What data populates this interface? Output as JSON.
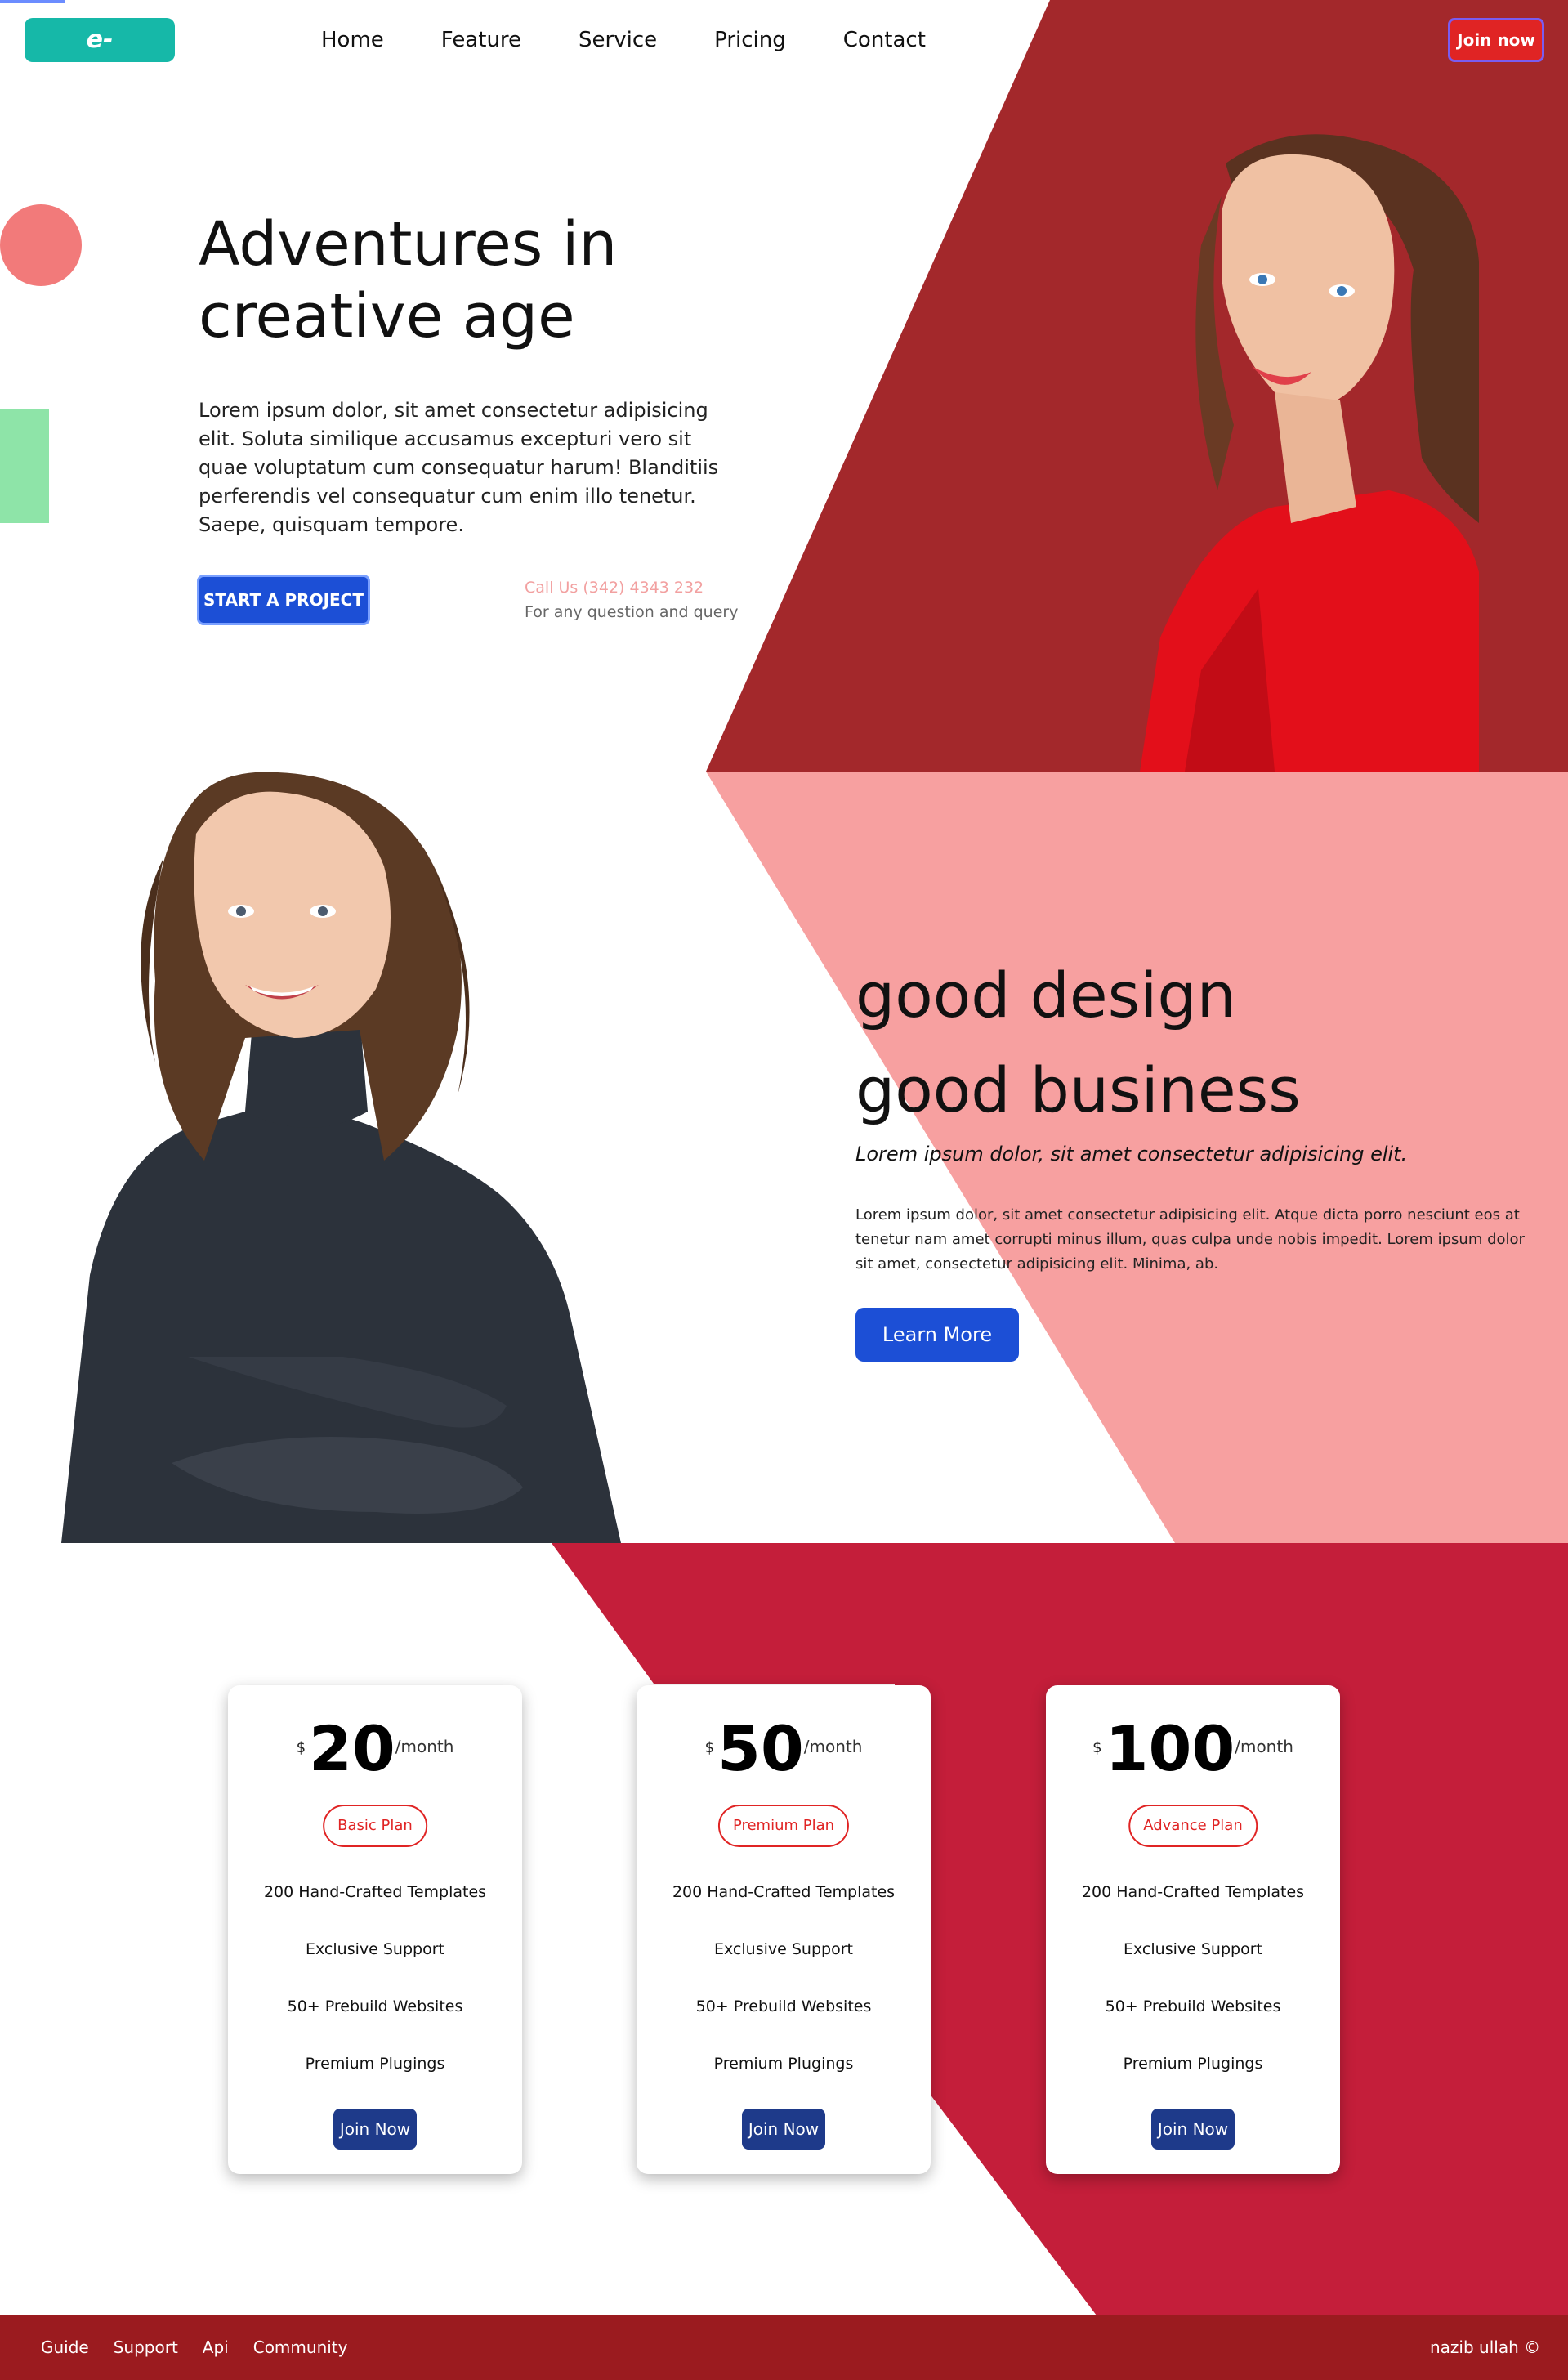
{
  "nav": {
    "logo": "e-commerce",
    "links": [
      "Home",
      "Feature",
      "Service",
      "Pricing",
      "Contact"
    ],
    "join_label": "Join now"
  },
  "hero": {
    "title_line1": "Adventures in",
    "title_line2": "creative age",
    "body": "Lorem ipsum dolor, sit amet consectetur adipisicing elit. Soluta similique accusamus excepturi vero sit quae voluptatum cum consequatur harum! Blanditiis perferendis vel consequatur cum enim illo tenetur. Saepe, quisquam tempore.",
    "cta_label": "START A PROJECT",
    "call_us": "Call Us (342) 4343 232",
    "call_sub": "For any question and query"
  },
  "design": {
    "title_line1": "good design",
    "title_line2": "good business",
    "italic": "Lorem ipsum dolor, sit amet consectetur adipisicing elit.",
    "body": "Lorem ipsum dolor, sit amet consectetur adipisicing elit. Atque dicta porro nesciunt eos at tenetur nam amet corrupti minus illum, quas culpa unde nobis impedit. Lorem ipsum dolor sit amet, consectetur adipisicing elit. Minima, ab.",
    "cta_label": "Learn More"
  },
  "pricing": {
    "plans": [
      {
        "currency": "$",
        "amount": "20",
        "period": "/month",
        "name": "Basic Plan",
        "features": [
          "200 Hand-Crafted Templates",
          "Exclusive Support",
          "50+ Prebuild Websites",
          "Premium Plugings"
        ],
        "button": "Join Now"
      },
      {
        "currency": "$",
        "amount": "50",
        "period": "/month",
        "name": "Premium Plan",
        "features": [
          "200 Hand-Crafted Templates",
          "Exclusive Support",
          "50+ Prebuild Websites",
          "Premium Plugings"
        ],
        "button": "Join Now"
      },
      {
        "currency": "$",
        "amount": "100",
        "period": "/month",
        "name": "Advance Plan",
        "features": [
          "200 Hand-Crafted Templates",
          "Exclusive Support",
          "50+ Prebuild Websites",
          "Premium Plugings"
        ],
        "button": "Join Now"
      }
    ]
  },
  "footer": {
    "links": [
      "Guide",
      "Support",
      "Api",
      "Community"
    ],
    "copyright": "nazib ullah ©"
  },
  "colors": {
    "hero_bg": "#a3282b",
    "design_bg": "#f7a0a0",
    "pricing_bg": "#c41e3a",
    "footer_bg": "#9b1b1f",
    "primary_button": "#1c4fd6",
    "logo_bg": "#16b8a8",
    "accent_red": "#e02424"
  }
}
